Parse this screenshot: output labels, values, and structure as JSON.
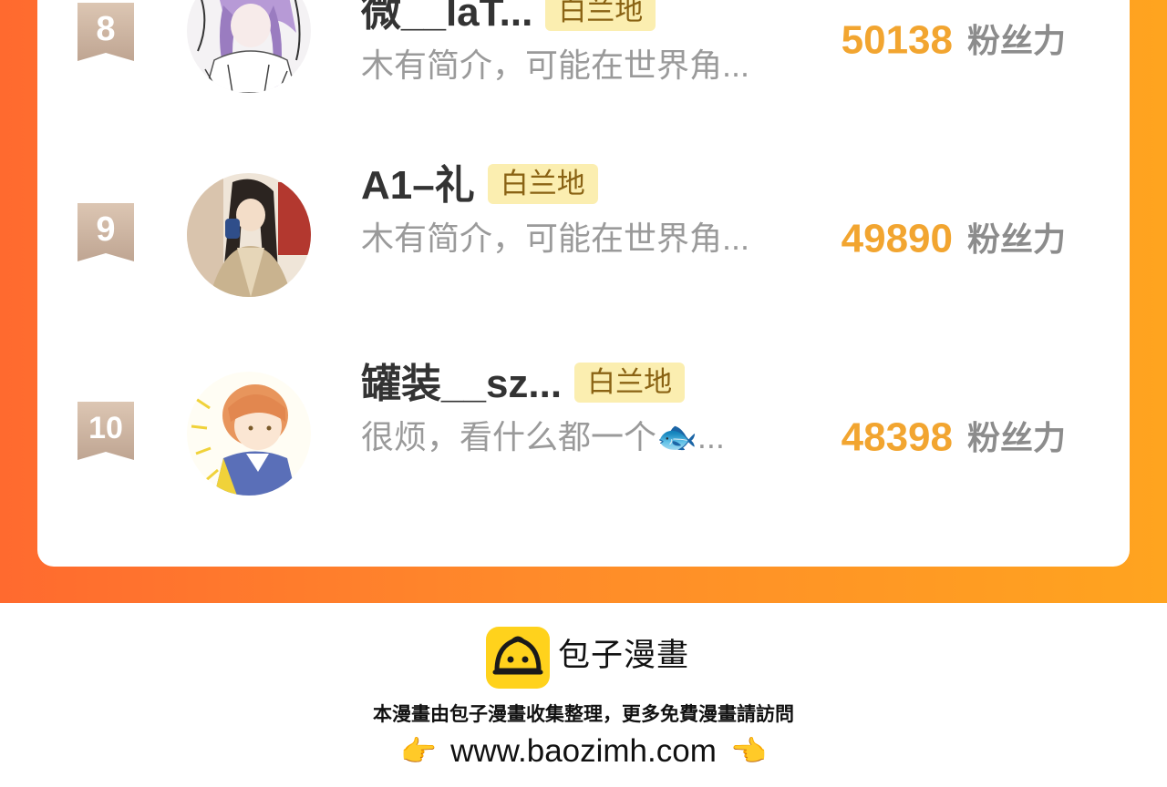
{
  "ranking": [
    {
      "rank": "8",
      "name": "微__laT...",
      "badge": "白兰地",
      "bio": "木有简介，可能在世界角...",
      "fans": "50138",
      "fans_unit": "粉丝力"
    },
    {
      "rank": "9",
      "name": "A1–礼",
      "badge": "白兰地",
      "bio": "木有简介，可能在世界角...",
      "fans": "49890",
      "fans_unit": "粉丝力"
    },
    {
      "rank": "10",
      "name": "罐装__sz...",
      "badge": "白兰地",
      "bio": "很烦，看什么都一个🐟...",
      "fans": "48398",
      "fans_unit": "粉丝力"
    }
  ],
  "footer": {
    "brand": "包子漫畫",
    "notice": "本漫畫由包子漫畫收集整理，更多免費漫畫請訪問",
    "url": "www.baozimh.com",
    "hand_left": "👉",
    "hand_right": "👈"
  },
  "colors": {
    "gradient_start": "#ff6a2f",
    "gradient_end": "#ffa41f",
    "fans_number": "#f2a530",
    "badge_bg": "#fbeeb0",
    "rank_ribbon": "#cbb29e",
    "logo_yellow": "#ffd21c"
  }
}
